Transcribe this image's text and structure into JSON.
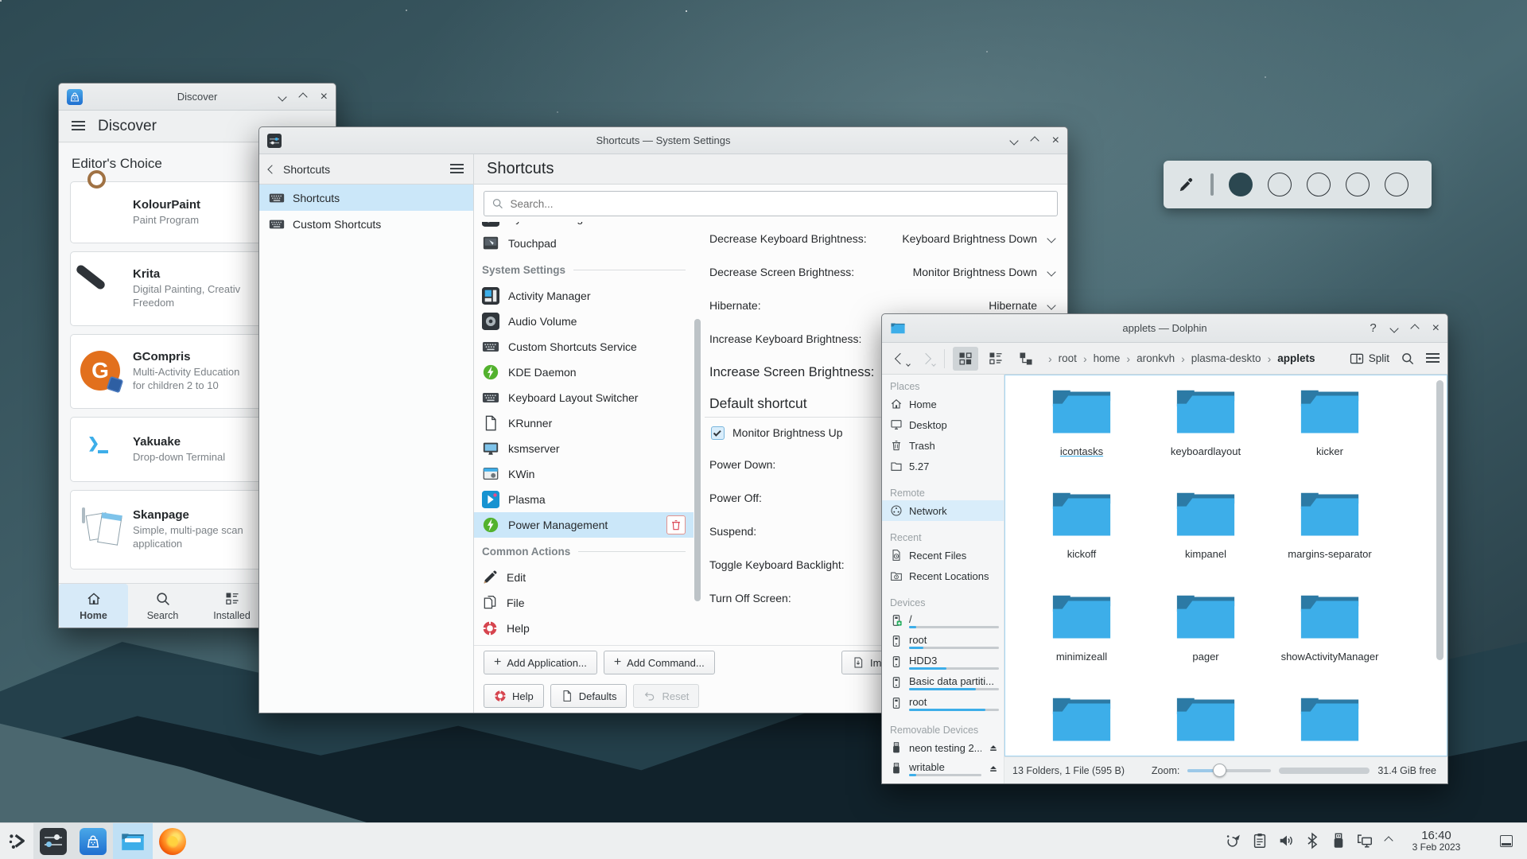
{
  "colors": {
    "accent": "#3daee9",
    "selection_light": "#cbe7f9",
    "folder_blue": "#3daee9",
    "folder_dark": "#2c7aa5",
    "titlebar": "#e7e9ea",
    "swatch_filled": "#2b4750"
  },
  "annotation_toolbar": {
    "tool": "color-picker",
    "empty_swatches": 4
  },
  "discover": {
    "window_title": "Discover",
    "app_title": "Discover",
    "section_title": "Editor's Choice",
    "apps": [
      {
        "name": "KolourPaint",
        "line1": "Paint Program",
        "line2": ""
      },
      {
        "name": "Krita",
        "line1": "Digital Painting, Creativ",
        "line2": "Freedom"
      },
      {
        "name": "GCompris",
        "line1": "Multi-Activity Education",
        "line2": "for children 2 to 10"
      },
      {
        "name": "Yakuake",
        "line1": "Drop-down Terminal",
        "line2": ""
      },
      {
        "name": "Skanpage",
        "line1": "Simple, multi-page scan",
        "line2": "application"
      }
    ],
    "nav": [
      {
        "label": "Home"
      },
      {
        "label": "Search"
      },
      {
        "label": "Installed"
      }
    ]
  },
  "system_settings": {
    "window_title": "Shortcuts — System Settings",
    "back_label": "Shortcuts",
    "nav_items": [
      {
        "label": "Shortcuts"
      },
      {
        "label": "Custom Shortcuts"
      }
    ],
    "page_title": "Shortcuts",
    "search_placeholder": "Search...",
    "list": {
      "top_items": [
        {
          "label": "System Settings"
        },
        {
          "label": "Touchpad"
        }
      ],
      "section1": "System Settings",
      "items": [
        {
          "label": "Activity Manager"
        },
        {
          "label": "Audio Volume"
        },
        {
          "label": "Custom Shortcuts Service"
        },
        {
          "label": "KDE Daemon"
        },
        {
          "label": "Keyboard Layout Switcher"
        },
        {
          "label": "KRunner"
        },
        {
          "label": "ksmserver"
        },
        {
          "label": "KWin"
        },
        {
          "label": "Plasma"
        },
        {
          "label": "Power Management"
        }
      ],
      "section2": "Common Actions",
      "actions": [
        {
          "label": "Edit"
        },
        {
          "label": "File"
        },
        {
          "label": "Help"
        }
      ]
    },
    "panel": {
      "rows": [
        {
          "label": "Decrease Keyboard Brightness:",
          "value": "Keyboard Brightness Down"
        },
        {
          "label": "Decrease Screen Brightness:",
          "value": "Monitor Brightness Down"
        },
        {
          "label": "Hibernate:",
          "value": "Hibernate"
        },
        {
          "label": "Increase Keyboard Brightness:",
          "value": ""
        },
        {
          "label": "Increase Screen Brightness:",
          "value": ""
        }
      ],
      "default_section": "Default shortcut",
      "checkbox_label": "Monitor Brightness Up",
      "checkbox_checked": true,
      "more_rows": [
        {
          "label": "Power Down:"
        },
        {
          "label": "Power Off:"
        },
        {
          "label": "Suspend:"
        },
        {
          "label": "Toggle Keyboard Backlight:"
        },
        {
          "label": "Turn Off Screen:"
        }
      ]
    },
    "footer": {
      "add_application": "Add Application...",
      "add_command": "Add Command...",
      "import_partial": "Imp",
      "help": "Help",
      "defaults": "Defaults",
      "reset": "Reset"
    }
  },
  "dolphin": {
    "window_title": "applets — Dolphin",
    "toolbar": {
      "split_label": "Split"
    },
    "breadcrumb": [
      {
        "label": "root"
      },
      {
        "label": "home"
      },
      {
        "label": "aronkvh"
      },
      {
        "label": "plasma-deskto"
      },
      {
        "label": "applets"
      }
    ],
    "sidebar": {
      "places_header": "Places",
      "places": [
        {
          "label": "Home"
        },
        {
          "label": "Desktop"
        },
        {
          "label": "Trash"
        },
        {
          "label": "5.27"
        }
      ],
      "remote_header": "Remote",
      "remote": [
        {
          "label": "Network"
        }
      ],
      "recent_header": "Recent",
      "recent": [
        {
          "label": "Recent Files"
        },
        {
          "label": "Recent Locations"
        }
      ],
      "devices_header": "Devices",
      "devices": [
        {
          "label": "/",
          "usage": 0.08
        },
        {
          "label": "root",
          "usage": 0.16
        },
        {
          "label": "HDD3",
          "usage": 0.42
        },
        {
          "label": "Basic data partiti...",
          "usage": 0.74
        },
        {
          "label": "root",
          "usage": 0.85
        }
      ],
      "removable_header": "Removable Devices",
      "removable": [
        {
          "label": "neon testing 2..."
        },
        {
          "label": "writable",
          "usage": 0.1
        }
      ]
    },
    "folders": [
      {
        "name": "icontasks"
      },
      {
        "name": "keyboardlayout"
      },
      {
        "name": "kicker"
      },
      {
        "name": "kickoff"
      },
      {
        "name": "kimpanel"
      },
      {
        "name": "margins-separator"
      },
      {
        "name": "minimizeall"
      },
      {
        "name": "pager"
      },
      {
        "name": "showActivityManager"
      }
    ],
    "status": {
      "items_text": "13 Folders, 1 File (595 B)",
      "zoom_label": "Zoom:",
      "free_text": "31.4 GiB free"
    }
  },
  "taskbar": {
    "clock_time": "16:40",
    "clock_date": "3 Feb 2023"
  }
}
